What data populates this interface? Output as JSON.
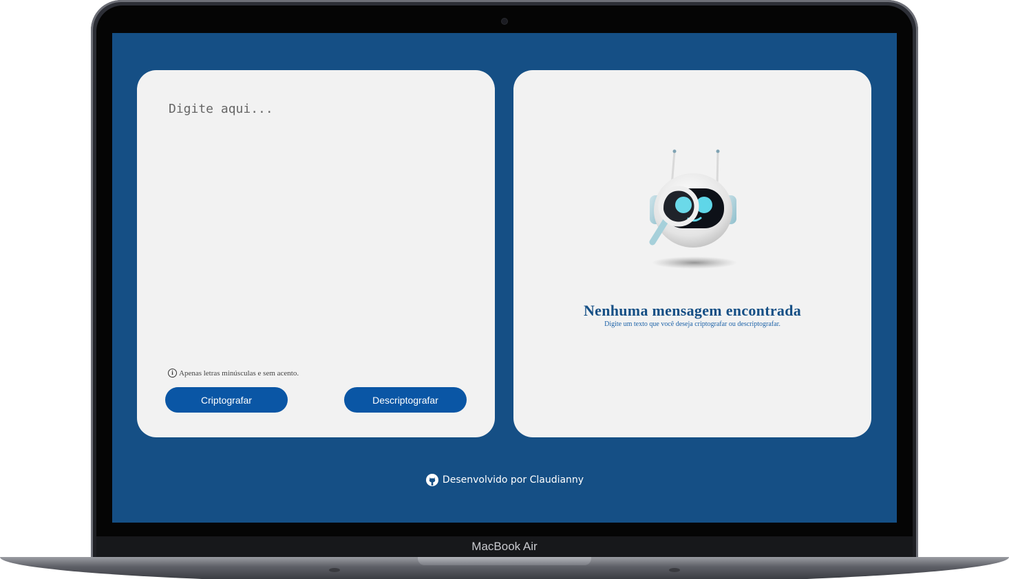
{
  "device": {
    "model_label": "MacBook Air"
  },
  "input": {
    "placeholder": "Digite aqui...",
    "value": "",
    "hint": "Apenas letras minúsculas e sem acento."
  },
  "buttons": {
    "encrypt_label": "Criptografar",
    "decrypt_label": "Descriptografar"
  },
  "output": {
    "title": "Nenhuma mensagem encontrada",
    "subtitle": "Digite um texto que você deseja criptografar ou descriptografar.",
    "illustration": "robot-with-magnifying-glass"
  },
  "footer": {
    "icon": "github-icon",
    "text": "Desenvolvido por Claudianny"
  },
  "colors": {
    "background": "#154f85",
    "card": "#f2f2f2",
    "button": "#0a56a5",
    "title": "#154f85",
    "robot_eyes": "#5fd6e8"
  }
}
